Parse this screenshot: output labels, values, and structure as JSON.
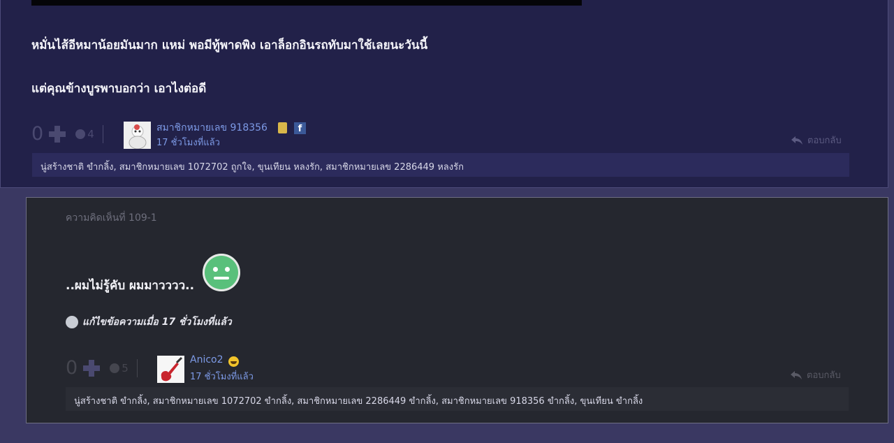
{
  "post1": {
    "line1": "หมั่นไส้อีหมาน้อยมันมาก แหม่ พอมีทู้พาดพิง  เอาล็อกอินรถทับมาใช้เลยนะวันนี้",
    "line2": "แต่คุณข้างบูรพาบอกว่า  เอาไงต่อดี",
    "votes": "0",
    "emotions": "4",
    "user": "สมาชิกหมายเลข 918356",
    "time": "17 ชั่วโมงที่แล้ว",
    "reply": "ตอบกลับ",
    "reactions": "นู่สร้างชาติ ขำกลิ้ง, สมาชิกหมายเลข 1072702 ถูกใจ, ขุนเทียน หลงรัก, สมาชิกหมายเลข 2286449 หลงรัก",
    "facebook_glyph": "f"
  },
  "post2": {
    "comment_number": "ความคิดเห็นที่ 109-1",
    "message": "..ผมไม่รู้คับ ผมมาวววว..",
    "edited": "แก้ไขข้อความเมื่อ 17 ชั่วโมงที่แล้ว",
    "votes": "0",
    "emotions": "5",
    "user": "Anico2",
    "time": "17 ชั่วโมงที่แล้ว",
    "reply": "ตอบกลับ",
    "reactions": "นู่สร้างชาติ ขำกลิ้ง, สมาชิกหมายเลข 1072702 ขำกลิ้ง, สมาชิกหมายเลข 2286449 ขำกลิ้ง, สมาชิกหมายเลข 918356 ขำกลิ้ง, ขุนเทียน ขำกลิ้ง"
  },
  "colors": {
    "page_bg": "#3a3862",
    "post_bg": "#222149",
    "reply_bg": "#25272f",
    "link": "#7d9ae6",
    "smiley": "#59c07b"
  },
  "icons": [
    "plus-vote-icon",
    "emotion-icon",
    "reply-arrow-icon",
    "facebook-icon",
    "user-badge-icon",
    "neutral-smiley-icon",
    "edit-info-icon",
    "grin-emoji-icon"
  ]
}
